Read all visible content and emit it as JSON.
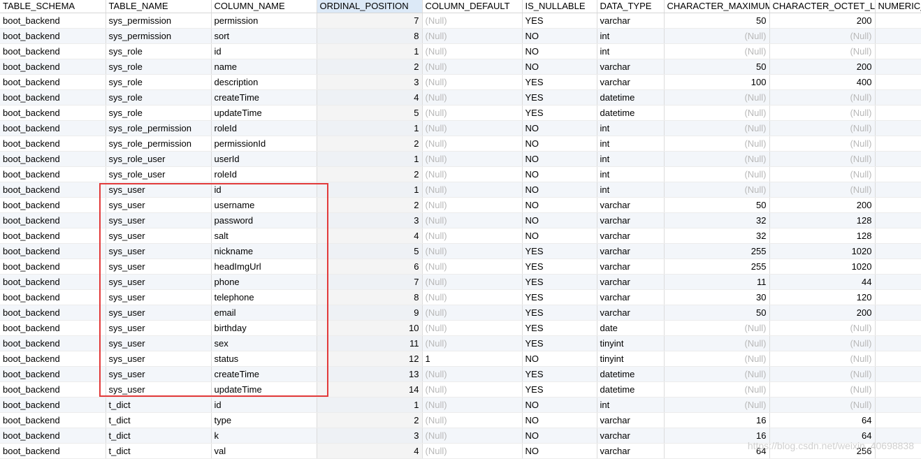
{
  "columns": [
    "TABLE_SCHEMA",
    "TABLE_NAME",
    "COLUMN_NAME",
    "ORDINAL_POSITION",
    "COLUMN_DEFAULT",
    "IS_NULLABLE",
    "DATA_TYPE",
    "CHARACTER_MAXIMUM_",
    "CHARACTER_OCTET_LENG",
    "NUMERIC_"
  ],
  "null_label": "(Null)",
  "rows": [
    [
      "boot_backend",
      "sys_permission",
      "permission",
      "7",
      null,
      "YES",
      "varchar",
      "50",
      "200"
    ],
    [
      "boot_backend",
      "sys_permission",
      "sort",
      "8",
      null,
      "NO",
      "int",
      null,
      null
    ],
    [
      "boot_backend",
      "sys_role",
      "id",
      "1",
      null,
      "NO",
      "int",
      null,
      null
    ],
    [
      "boot_backend",
      "sys_role",
      "name",
      "2",
      null,
      "NO",
      "varchar",
      "50",
      "200"
    ],
    [
      "boot_backend",
      "sys_role",
      "description",
      "3",
      null,
      "YES",
      "varchar",
      "100",
      "400"
    ],
    [
      "boot_backend",
      "sys_role",
      "createTime",
      "4",
      null,
      "YES",
      "datetime",
      null,
      null
    ],
    [
      "boot_backend",
      "sys_role",
      "updateTime",
      "5",
      null,
      "YES",
      "datetime",
      null,
      null
    ],
    [
      "boot_backend",
      "sys_role_permission",
      "roleId",
      "1",
      null,
      "NO",
      "int",
      null,
      null
    ],
    [
      "boot_backend",
      "sys_role_permission",
      "permissionId",
      "2",
      null,
      "NO",
      "int",
      null,
      null
    ],
    [
      "boot_backend",
      "sys_role_user",
      "userId",
      "1",
      null,
      "NO",
      "int",
      null,
      null
    ],
    [
      "boot_backend",
      "sys_role_user",
      "roleId",
      "2",
      null,
      "NO",
      "int",
      null,
      null
    ],
    [
      "boot_backend",
      "sys_user",
      "id",
      "1",
      null,
      "NO",
      "int",
      null,
      null
    ],
    [
      "boot_backend",
      "sys_user",
      "username",
      "2",
      null,
      "NO",
      "varchar",
      "50",
      "200"
    ],
    [
      "boot_backend",
      "sys_user",
      "password",
      "3",
      null,
      "NO",
      "varchar",
      "32",
      "128"
    ],
    [
      "boot_backend",
      "sys_user",
      "salt",
      "4",
      null,
      "NO",
      "varchar",
      "32",
      "128"
    ],
    [
      "boot_backend",
      "sys_user",
      "nickname",
      "5",
      null,
      "YES",
      "varchar",
      "255",
      "1020"
    ],
    [
      "boot_backend",
      "sys_user",
      "headImgUrl",
      "6",
      null,
      "YES",
      "varchar",
      "255",
      "1020"
    ],
    [
      "boot_backend",
      "sys_user",
      "phone",
      "7",
      null,
      "YES",
      "varchar",
      "11",
      "44"
    ],
    [
      "boot_backend",
      "sys_user",
      "telephone",
      "8",
      null,
      "YES",
      "varchar",
      "30",
      "120"
    ],
    [
      "boot_backend",
      "sys_user",
      "email",
      "9",
      null,
      "YES",
      "varchar",
      "50",
      "200"
    ],
    [
      "boot_backend",
      "sys_user",
      "birthday",
      "10",
      null,
      "YES",
      "date",
      null,
      null
    ],
    [
      "boot_backend",
      "sys_user",
      "sex",
      "11",
      null,
      "YES",
      "tinyint",
      null,
      null
    ],
    [
      "boot_backend",
      "sys_user",
      "status",
      "12",
      "1",
      "NO",
      "tinyint",
      null,
      null
    ],
    [
      "boot_backend",
      "sys_user",
      "createTime",
      "13",
      null,
      "YES",
      "datetime",
      null,
      null
    ],
    [
      "boot_backend",
      "sys_user",
      "updateTime",
      "14",
      null,
      "YES",
      "datetime",
      null,
      null
    ],
    [
      "boot_backend",
      "t_dict",
      "id",
      "1",
      null,
      "NO",
      "int",
      null,
      null
    ],
    [
      "boot_backend",
      "t_dict",
      "type",
      "2",
      null,
      "NO",
      "varchar",
      "16",
      "64"
    ],
    [
      "boot_backend",
      "t_dict",
      "k",
      "3",
      null,
      "NO",
      "varchar",
      "16",
      "64"
    ],
    [
      "boot_backend",
      "t_dict",
      "val",
      "4",
      null,
      "NO",
      "varchar",
      "64",
      "256"
    ]
  ],
  "watermark": "https://blog.csdn.net/weixin_40698838",
  "colors": {
    "highlight": "#e23a3a",
    "null_text": "#b8b8b8",
    "sorted_header": "#dce9f7"
  }
}
